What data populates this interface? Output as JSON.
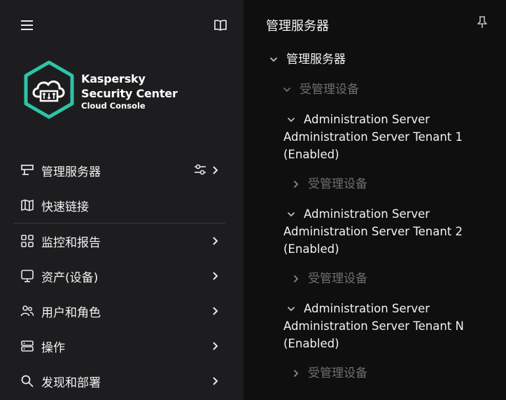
{
  "sidebar": {
    "brand": {
      "line1": "Kaspersky",
      "line2": "Security Center",
      "line3": "Cloud Console"
    },
    "items": [
      {
        "label": "管理服务器",
        "icon": "server-icon",
        "has_filter": true,
        "has_chevron": true
      },
      {
        "label": "快速链接",
        "icon": "map-icon",
        "has_filter": false,
        "has_chevron": false
      },
      {
        "label": "监控和报告",
        "icon": "dashboard-icon",
        "has_filter": false,
        "has_chevron": true
      },
      {
        "label": "资产(设备)",
        "icon": "monitor-icon",
        "has_filter": false,
        "has_chevron": true
      },
      {
        "label": "用户和角色",
        "icon": "users-icon",
        "has_filter": false,
        "has_chevron": true
      },
      {
        "label": "操作",
        "icon": "operations-icon",
        "has_filter": false,
        "has_chevron": true
      },
      {
        "label": "发现和部署",
        "icon": "search-icon",
        "has_filter": false,
        "has_chevron": true
      }
    ]
  },
  "panel": {
    "title": "管理服务器",
    "tree": {
      "root": "管理服务器",
      "managed_devices": "受管理设备",
      "servers": [
        {
          "line1": "Administration Server",
          "line2": "Administration Server Tenant 1",
          "line3": "(Enabled)",
          "child": "受管理设备"
        },
        {
          "line1": "Administration Server",
          "line2": "Administration Server Tenant 2",
          "line3": "(Enabled)",
          "child": "受管理设备"
        },
        {
          "line1": "Administration Server",
          "line2": "Administration Server Tenant N",
          "line3": "(Enabled)",
          "child": "受管理设备"
        }
      ]
    }
  },
  "colors": {
    "sidebar_bg": "#1d1d1f",
    "panel_bg": "#0f0f10",
    "accent": "#2ec4a6",
    "muted_text": "#6f6f73"
  }
}
